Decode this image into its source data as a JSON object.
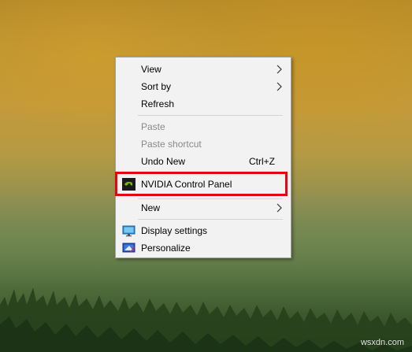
{
  "menu": {
    "items": [
      {
        "label": "View",
        "submenu": true
      },
      {
        "label": "Sort by",
        "submenu": true
      },
      {
        "label": "Refresh"
      },
      {
        "label": "Paste",
        "disabled": true
      },
      {
        "label": "Paste shortcut",
        "disabled": true
      },
      {
        "label": "Undo New",
        "shortcut": "Ctrl+Z"
      },
      {
        "label": "NVIDIA Control Panel",
        "icon": "nvidia-icon",
        "highlighted": true
      },
      {
        "label": "New",
        "submenu": true
      },
      {
        "label": "Display settings",
        "icon": "display-settings-icon"
      },
      {
        "label": "Personalize",
        "icon": "personalize-icon"
      }
    ]
  },
  "highlight_color": "#e30613",
  "watermark": "wsxdn.com"
}
